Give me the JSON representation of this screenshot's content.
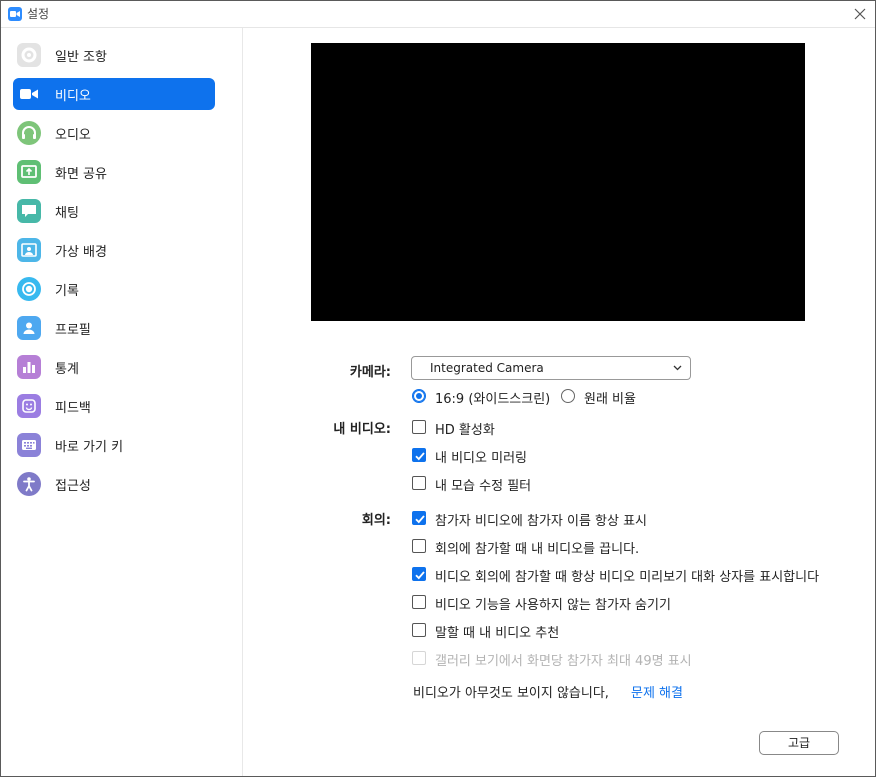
{
  "window": {
    "title": "설정"
  },
  "sidebar": {
    "items": [
      {
        "label": "일반 조항",
        "icon": "gear-icon",
        "color": "#e0e0e0"
      },
      {
        "label": "비디오",
        "icon": "video-camera-icon",
        "color": "#0e72ed"
      },
      {
        "label": "오디오",
        "icon": "headphones-icon",
        "color": "#7ec57a"
      },
      {
        "label": "화면 공유",
        "icon": "share-screen-icon",
        "color": "#5fbf74"
      },
      {
        "label": "채팅",
        "icon": "chat-bubble-icon",
        "color": "#47b8a8"
      },
      {
        "label": "가상 배경",
        "icon": "person-frame-icon",
        "color": "#4db6e8"
      },
      {
        "label": "기록",
        "icon": "record-icon",
        "color": "#38b9ef"
      },
      {
        "label": "프로필",
        "icon": "profile-icon",
        "color": "#4ea8f0"
      },
      {
        "label": "통계",
        "icon": "bar-chart-icon",
        "color": "#b67fd6"
      },
      {
        "label": "피드백",
        "icon": "smiley-icon",
        "color": "#9b7de2"
      },
      {
        "label": "바로 가기 키",
        "icon": "keyboard-icon",
        "color": "#8b82d8"
      },
      {
        "label": "접근성",
        "icon": "accessibility-icon",
        "color": "#7f7ac8"
      }
    ],
    "active_index": 1
  },
  "video": {
    "camera_label": "카메라:",
    "camera_value": "Integrated Camera",
    "aspect_options": [
      {
        "label": "16:9 (와이드스크린)",
        "selected": true
      },
      {
        "label": "원래 비율",
        "selected": false
      }
    ],
    "my_video_label": "내 비디오:",
    "my_video_options": [
      {
        "label": "HD 활성화",
        "checked": false
      },
      {
        "label": "내 비디오 미러링",
        "checked": true
      },
      {
        "label": "내 모습 수정 필터",
        "checked": false
      }
    ],
    "meeting_label": "회의:",
    "meeting_options": [
      {
        "label": "참가자 비디오에 참가자 이름 항상 표시",
        "checked": true,
        "disabled": false
      },
      {
        "label": "회의에 참가할 때 내 비디오를 끕니다.",
        "checked": false,
        "disabled": false
      },
      {
        "label": "비디오 회의에 참가할 때 항상 비디오 미리보기 대화 상자를 표시합니다",
        "checked": true,
        "disabled": false
      },
      {
        "label": "비디오 기능을 사용하지 않는 참가자 숨기기",
        "checked": false,
        "disabled": false
      },
      {
        "label": "말할 때 내 비디오 추천",
        "checked": false,
        "disabled": false
      },
      {
        "label": "갤러리 보기에서 화면당 참가자 최대 49명 표시",
        "checked": false,
        "disabled": true
      }
    ],
    "trouble_text": "비디오가 아무것도 보이지 않습니다,",
    "trouble_link": "문제 해결",
    "advanced_button": "고급"
  }
}
